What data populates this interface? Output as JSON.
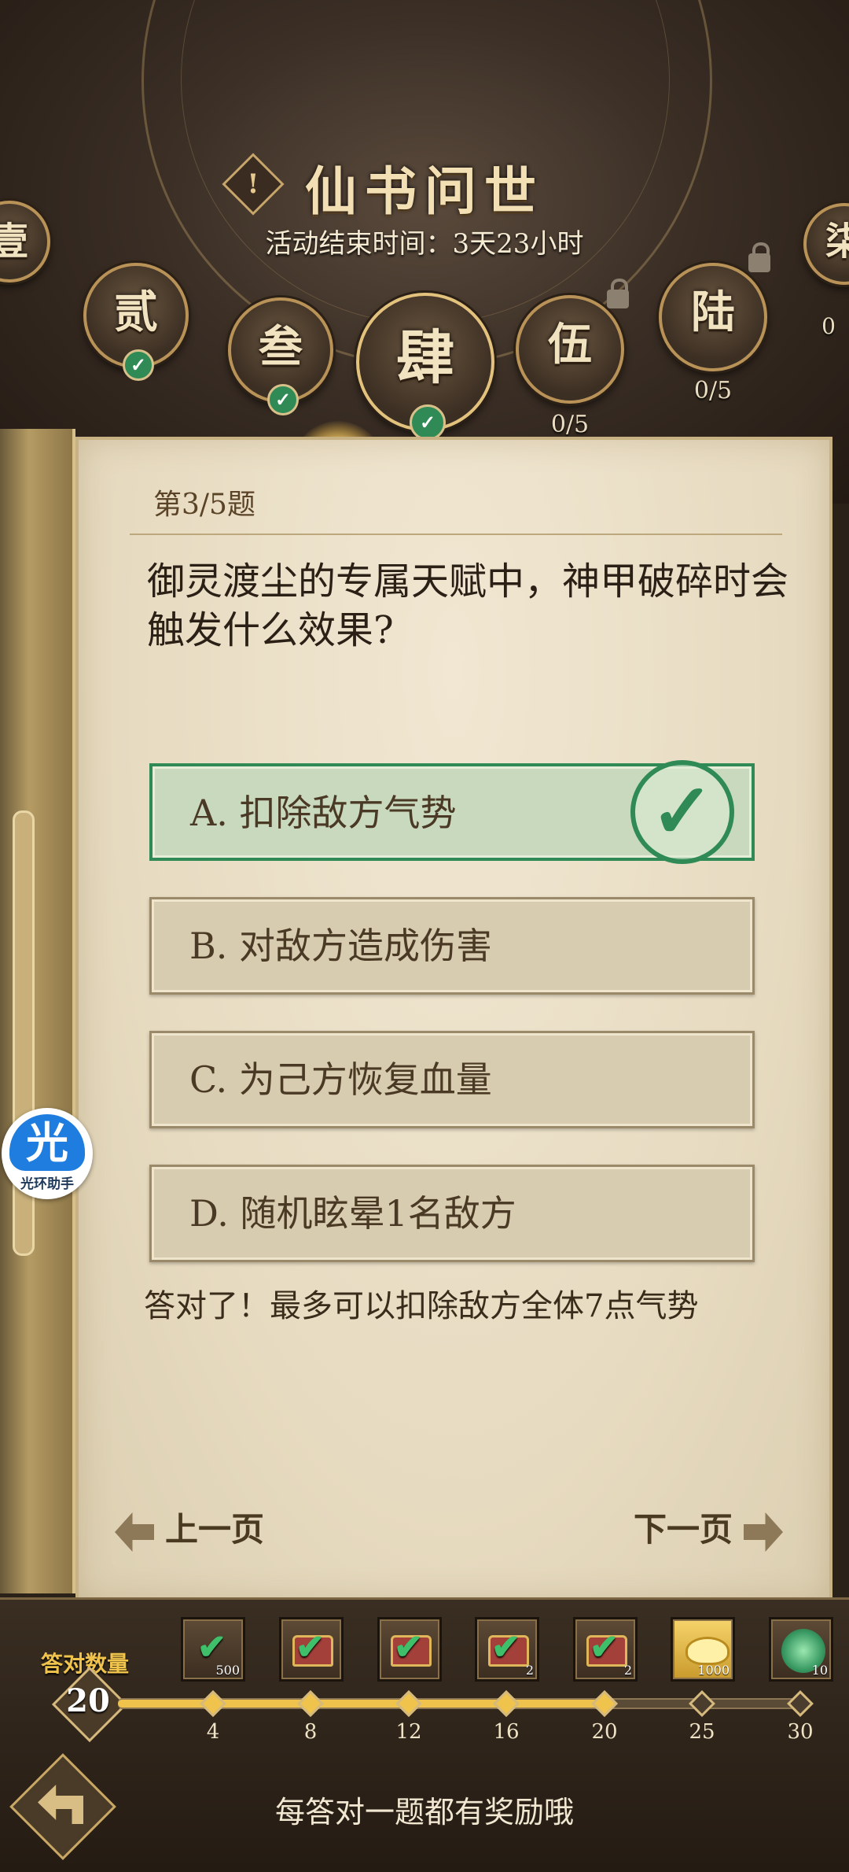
{
  "header": {
    "title": "仙书问世",
    "alert_icon": "!",
    "end_time": "活动结束时间：3天23小时"
  },
  "chapters": [
    {
      "label": "壹",
      "progress": "",
      "completed": true,
      "locked": false
    },
    {
      "label": "贰",
      "progress": "",
      "completed": true,
      "locked": false
    },
    {
      "label": "叁",
      "progress": "",
      "completed": true,
      "locked": false
    },
    {
      "label": "肆",
      "progress": "",
      "completed": true,
      "locked": false,
      "current": true
    },
    {
      "label": "伍",
      "progress": "0/5",
      "completed": false,
      "locked": true
    },
    {
      "label": "陆",
      "progress": "0/5",
      "completed": false,
      "locked": true
    },
    {
      "label": "柒",
      "progress": "0",
      "completed": false,
      "locked": true
    }
  ],
  "quiz": {
    "question_number": "第3/5题",
    "question": "御灵渡尘的专属天赋中，神甲破碎时会触发什么效果?",
    "options": [
      {
        "label": "A. 扣除敌方气势",
        "correct": true
      },
      {
        "label": "B. 对敌方造成伤害",
        "correct": false
      },
      {
        "label": "C. 为己方恢复血量",
        "correct": false
      },
      {
        "label": "D. 随机眩晕1名敌方",
        "correct": false
      }
    ],
    "answer_feedback": "答对了！最多可以扣除敌方全体7点气势",
    "prev_label": "上一页",
    "next_label": "下一页"
  },
  "progress": {
    "count_label": "答对数量",
    "count_value": "20",
    "current": 20,
    "max": 30,
    "milestones": [
      {
        "value": "4",
        "reached": true,
        "reward": "jade-check",
        "qty": "500"
      },
      {
        "value": "8",
        "reached": true,
        "reward": "chest",
        "qty": ""
      },
      {
        "value": "12",
        "reached": true,
        "reward": "chest",
        "qty": ""
      },
      {
        "value": "16",
        "reached": true,
        "reward": "chest",
        "qty": "2"
      },
      {
        "value": "20",
        "reached": true,
        "reward": "chest",
        "qty": "2"
      },
      {
        "value": "25",
        "reached": false,
        "reward": "gold-ingot",
        "qty": "1000"
      },
      {
        "value": "30",
        "reached": false,
        "reward": "jade-orb",
        "qty": "10"
      }
    ]
  },
  "footer": {
    "hint": "每答对一题都有奖励哦"
  },
  "helper": {
    "icon_char": "光",
    "label": "光环助手"
  },
  "colors": {
    "correct_green": "#2f8a55",
    "gold": "#f0c44c"
  }
}
